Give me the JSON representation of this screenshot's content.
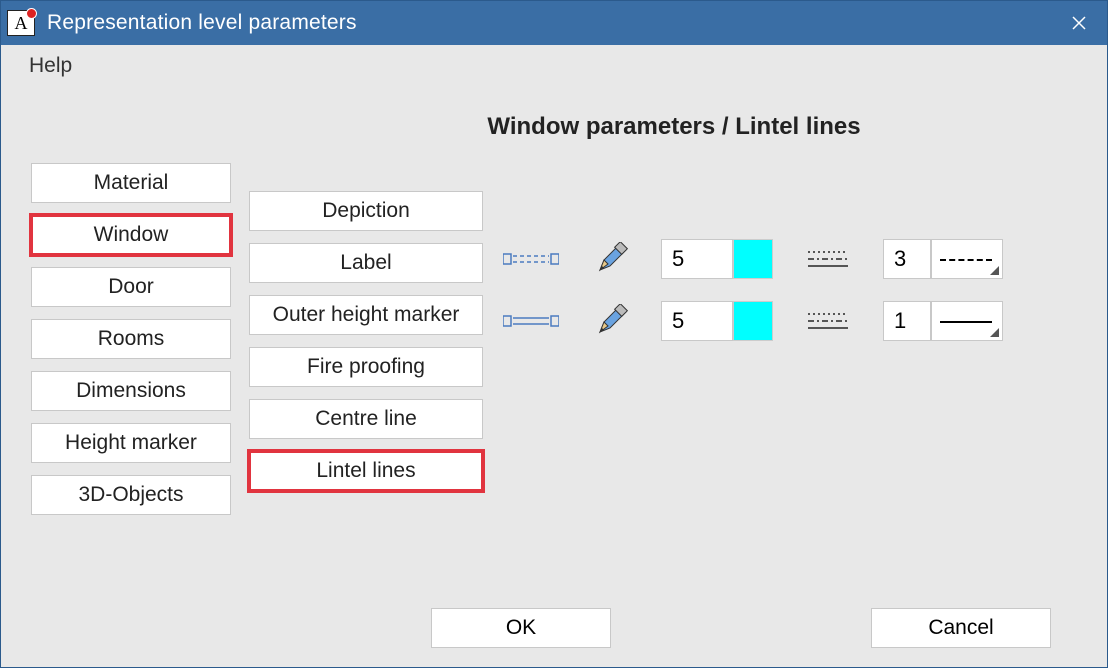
{
  "window": {
    "title": "Representation level parameters",
    "app_icon_letter": "A"
  },
  "menu": {
    "help": "Help"
  },
  "page_title": "Window parameters / Lintel lines",
  "categories": {
    "items": [
      {
        "label": "Material",
        "selected": false
      },
      {
        "label": "Window",
        "selected": true
      },
      {
        "label": "Door",
        "selected": false
      },
      {
        "label": "Rooms",
        "selected": false
      },
      {
        "label": "Dimensions",
        "selected": false
      },
      {
        "label": "Height marker",
        "selected": false
      },
      {
        "label": "3D-Objects",
        "selected": false
      }
    ]
  },
  "subcategories": {
    "items": [
      {
        "label": "Depiction",
        "selected": false
      },
      {
        "label": "Label",
        "selected": false
      },
      {
        "label": "Outer height marker",
        "selected": false
      },
      {
        "label": "Fire proofing",
        "selected": false
      },
      {
        "label": "Centre line",
        "selected": false
      },
      {
        "label": "Lintel lines",
        "selected": true
      }
    ]
  },
  "params": {
    "row1": {
      "pen": "5",
      "color": "#00ffff",
      "linetype": "3",
      "style": "dashed"
    },
    "row2": {
      "pen": "5",
      "color": "#00ffff",
      "linetype": "1",
      "style": "solid"
    }
  },
  "footer": {
    "ok": "OK",
    "cancel": "Cancel"
  }
}
